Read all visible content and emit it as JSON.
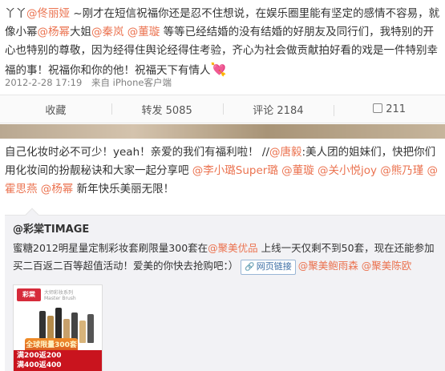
{
  "post1": {
    "segments": [
      {
        "t": "丫丫",
        "at": false
      },
      {
        "t": "@佟丽娅",
        "at": true
      },
      {
        "t": " ~刚才在短信祝福你还是忍不住想说，在娱乐圈里能有坚定的感情不容易，就像小幂",
        "at": false
      },
      {
        "t": "@杨幂",
        "at": true
      },
      {
        "t": "大姐",
        "at": false
      },
      {
        "t": "@秦岚",
        "at": true
      },
      {
        "t": " ",
        "at": false
      },
      {
        "t": "@董璇",
        "at": true
      },
      {
        "t": " 等等已经结婚的没有结婚的好朋友及同行们，我特别的开心也特别的尊敬，因为经得住舆论经得住考验，齐心为社会做贡献拍好看的戏是一件特别幸福的事！祝福你和你的他！祝福天下有情人",
        "at": false
      }
    ],
    "heart": "💘",
    "time": "2012-2-28 17:19",
    "source": "来自 iPhone客户端"
  },
  "actions": {
    "collect": "收藏",
    "repost": "转发 5085",
    "comment": "评论 2184",
    "like": "211"
  },
  "post2": {
    "segments": [
      {
        "t": "自己化妆时必不可少！yeah！亲爱的我们有福利啦！ //",
        "at": false
      },
      {
        "t": "@唐毅",
        "at": true
      },
      {
        "t": ":美人团的姐妹们，快把你们用化妆间的扮靓秘诀和大家一起分享吧 ",
        "at": false
      },
      {
        "t": "@李小璐Super璐",
        "at": true
      },
      {
        "t": " ",
        "at": false
      },
      {
        "t": "@董璇",
        "at": true
      },
      {
        "t": " ",
        "at": false
      },
      {
        "t": "@关小悦joy",
        "at": true
      },
      {
        "t": " ",
        "at": false
      },
      {
        "t": "@熊乃瑾",
        "at": true
      },
      {
        "t": " ",
        "at": false
      },
      {
        "t": "@霍思燕",
        "at": true
      },
      {
        "t": " ",
        "at": false
      },
      {
        "t": "@杨幂",
        "at": true
      },
      {
        "t": " 新年快乐美丽无限！",
        "at": false
      }
    ]
  },
  "repost": {
    "author": "@彩棠TIMAGE",
    "segments": [
      {
        "t": "蜜糖2012明星量定制彩妆套刷限量300套在",
        "at": false
      },
      {
        "t": "@聚美优品",
        "at": true
      },
      {
        "t": " 上线一天仅剩不到50套，现在还能参加买二百返二百等超值活动！爱美的你快去抢购吧：）",
        "at": false
      }
    ],
    "link_label": "网页链接",
    "tail_mentions": [
      "@聚美鲍雨森",
      "@聚美陈欧"
    ],
    "ad": {
      "logo": "彩棠",
      "subtitle_1": "大师彩妆系列",
      "subtitle_2": "Master Brush",
      "banner": "全球限量300套",
      "line_1": "满200返200",
      "line_2": "满400返400"
    }
  },
  "colors": {
    "mention": "#eb7350",
    "link": "#3b6ea5",
    "ad_red": "#c9141e"
  }
}
